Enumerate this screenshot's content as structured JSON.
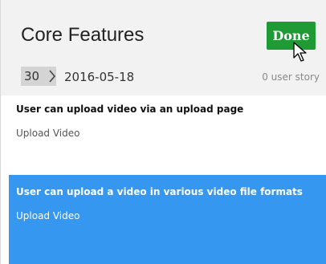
{
  "header": {
    "title": "Core Features",
    "done_label": "Done"
  },
  "sprint": {
    "number": "30",
    "date": "2016-05-18",
    "story_count": "0 user story"
  },
  "stories": [
    {
      "title": "User can upload video via an upload page",
      "feature": "Upload Video",
      "selected": false
    },
    {
      "title": "User can upload a video in various video file formats",
      "feature": "Upload Video",
      "selected": true
    }
  ],
  "icons": {
    "chevron": "chevron-right-icon",
    "cursor": "mouse-pointer-icon"
  },
  "colors": {
    "done_button": "#1f9a34",
    "selected_row": "#3597ef",
    "header_bg": "#f2f2f2"
  }
}
